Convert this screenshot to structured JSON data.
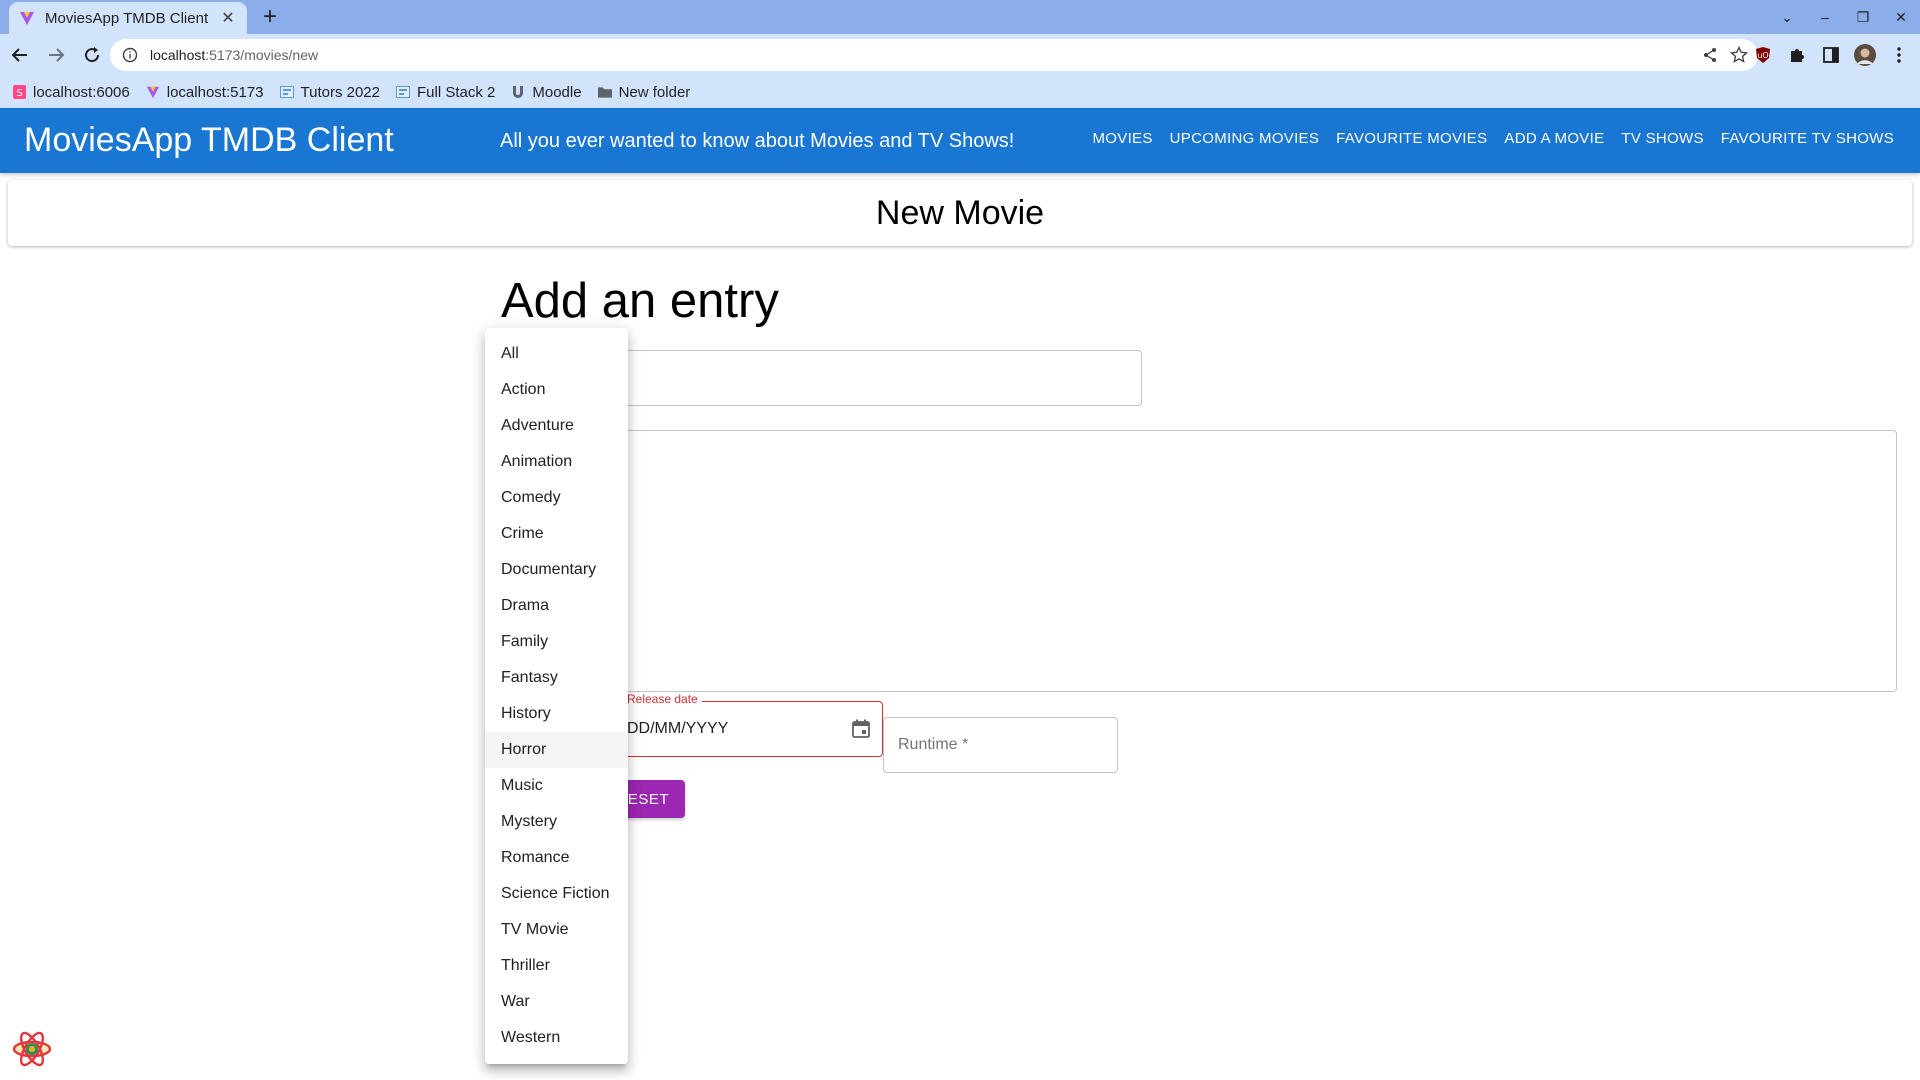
{
  "browser": {
    "tab_title": "MoviesApp TMDB Client",
    "url_host": "localhost",
    "url_path": ":5173/movies/new",
    "bookmarks": [
      {
        "label": "localhost:6006"
      },
      {
        "label": "localhost:5173"
      },
      {
        "label": "Tutors 2022"
      },
      {
        "label": "Full Stack 2"
      },
      {
        "label": "Moodle"
      },
      {
        "label": "New folder"
      }
    ]
  },
  "app": {
    "title": "MoviesApp TMDB Client",
    "tagline": "All you ever wanted to know about Movies and TV Shows!",
    "nav": [
      {
        "label": "MOVIES"
      },
      {
        "label": "UPCOMING MOVIES"
      },
      {
        "label": "FAVOURITE MOVIES"
      },
      {
        "label": "ADD A MOVIE"
      },
      {
        "label": "TV SHOWS"
      },
      {
        "label": "FAVOURITE TV SHOWS"
      }
    ]
  },
  "page": {
    "header": "New Movie",
    "form_title": "Add an entry"
  },
  "form": {
    "release_date_label": "Release date",
    "release_date_value": "DD/MM/YYYY",
    "runtime_label": "Runtime *",
    "reset_label": "RESET"
  },
  "genre_menu": {
    "items": [
      {
        "label": "All"
      },
      {
        "label": "Action"
      },
      {
        "label": "Adventure"
      },
      {
        "label": "Animation"
      },
      {
        "label": "Comedy"
      },
      {
        "label": "Crime"
      },
      {
        "label": "Documentary"
      },
      {
        "label": "Drama"
      },
      {
        "label": "Family"
      },
      {
        "label": "Fantasy"
      },
      {
        "label": "History"
      },
      {
        "label": "Horror"
      },
      {
        "label": "Music"
      },
      {
        "label": "Mystery"
      },
      {
        "label": "Romance"
      },
      {
        "label": "Science Fiction"
      },
      {
        "label": "TV Movie"
      },
      {
        "label": "Thriller"
      },
      {
        "label": "War"
      },
      {
        "label": "Western"
      }
    ],
    "hovered": "Horror"
  },
  "colors": {
    "appbar": "#1976d2",
    "reset_button": "#9c27b0",
    "error": "#d32f2f",
    "browser_frame": "#8badea"
  }
}
